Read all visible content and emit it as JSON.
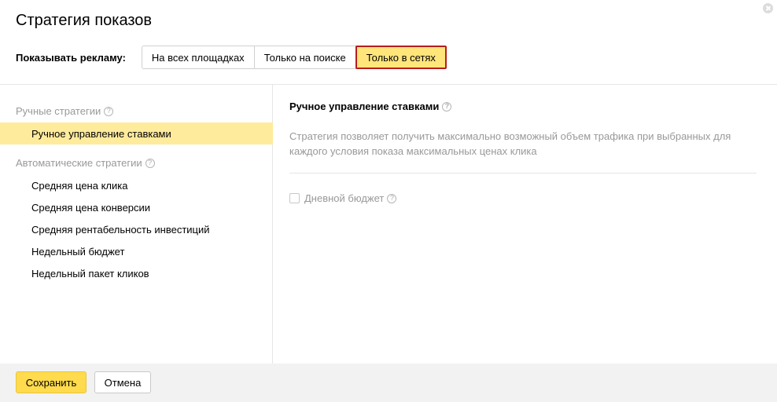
{
  "dialog": {
    "title": "Стратегия показов"
  },
  "show": {
    "label": "Показывать рекламу:",
    "options": [
      "На всех площадках",
      "Только на поиске",
      "Только в сетях"
    ],
    "selected_index": 2
  },
  "sidebar": {
    "manual_group": "Ручные стратегии",
    "manual_items": [
      "Ручное управление ставками"
    ],
    "auto_group": "Автоматические стратегии",
    "auto_items": [
      "Средняя цена клика",
      "Средняя цена конверсии",
      "Средняя рентабельность инвестиций",
      "Недельный бюджет",
      "Недельный пакет кликов"
    ]
  },
  "main": {
    "heading": "Ручное управление ставками",
    "description": "Стратегия позволяет получить максимально возможный объем трафика при выбранных для каждого условия показа максимальных ценах клика",
    "daily_budget_label": "Дневной бюджет",
    "daily_budget_checked": false
  },
  "footer": {
    "save_label": "Сохранить",
    "cancel_label": "Отмена"
  },
  "icons": {
    "help": "?",
    "close": "close-icon"
  },
  "colors": {
    "selected_bg": "#ffeb9c",
    "active_option_bg": "#ffe57a",
    "highlight_border": "#b71c1c",
    "save_button": "#ffdb4d"
  }
}
